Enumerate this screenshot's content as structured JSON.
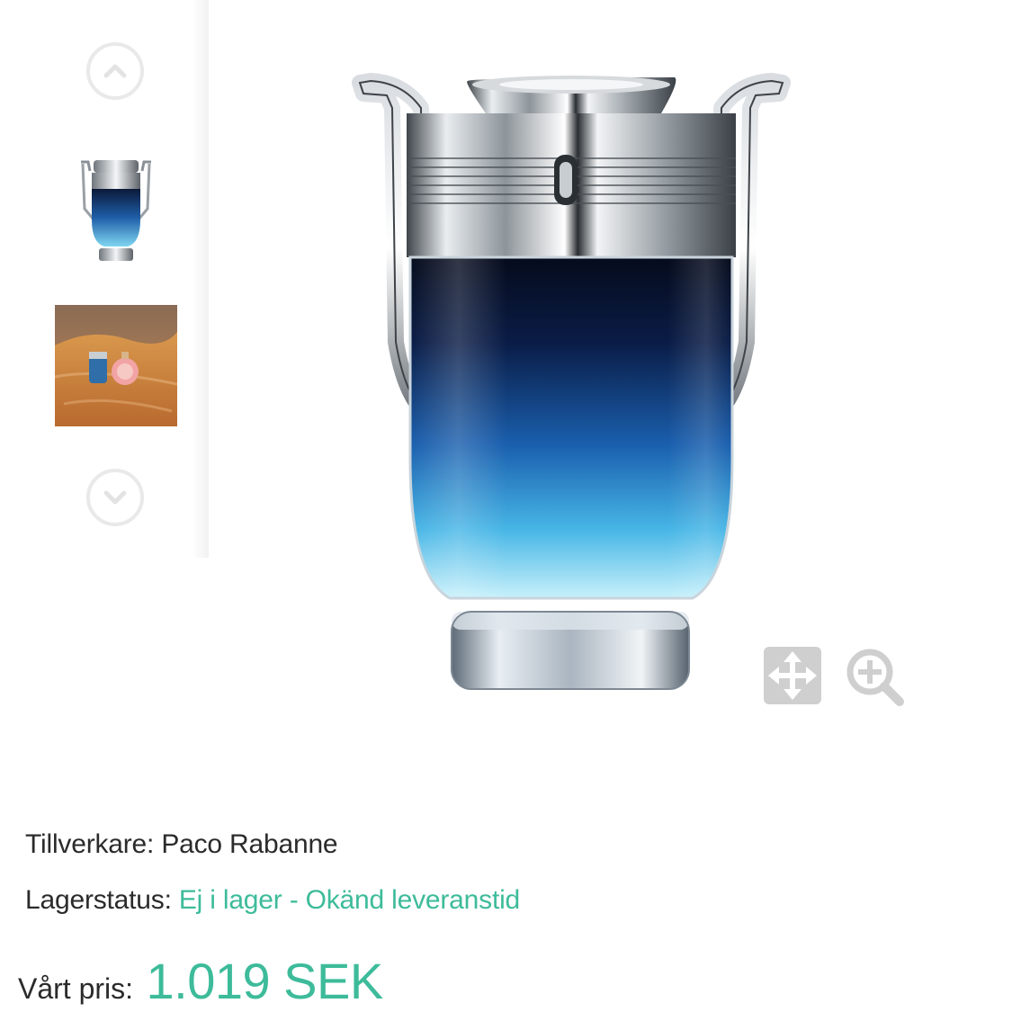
{
  "gallery": {
    "scroll_up_icon": "chevron-up-circle",
    "scroll_down_icon": "chevron-down-circle",
    "thumbnails": [
      {
        "icon": "perfume-bottle-thumbnail"
      },
      {
        "icon": "desert-scene-thumbnail"
      }
    ],
    "main_image_icon": "trophy-perfume-bottle",
    "tools": {
      "move_icon": "move-arrows",
      "zoom_icon": "zoom-in-magnifier"
    }
  },
  "product": {
    "manufacturer_label": "Tillverkare:",
    "manufacturer": "Paco Rabanne",
    "stock_label": "Lagerstatus:",
    "stock_status": "Ej i lager - Okänd leveranstid",
    "price_label": "Vårt pris:",
    "price": "1.019 SEK"
  },
  "colors": {
    "accent": "#3dbb9a",
    "text": "#2b2b2b",
    "icon_gray": "#cfcfcf"
  }
}
